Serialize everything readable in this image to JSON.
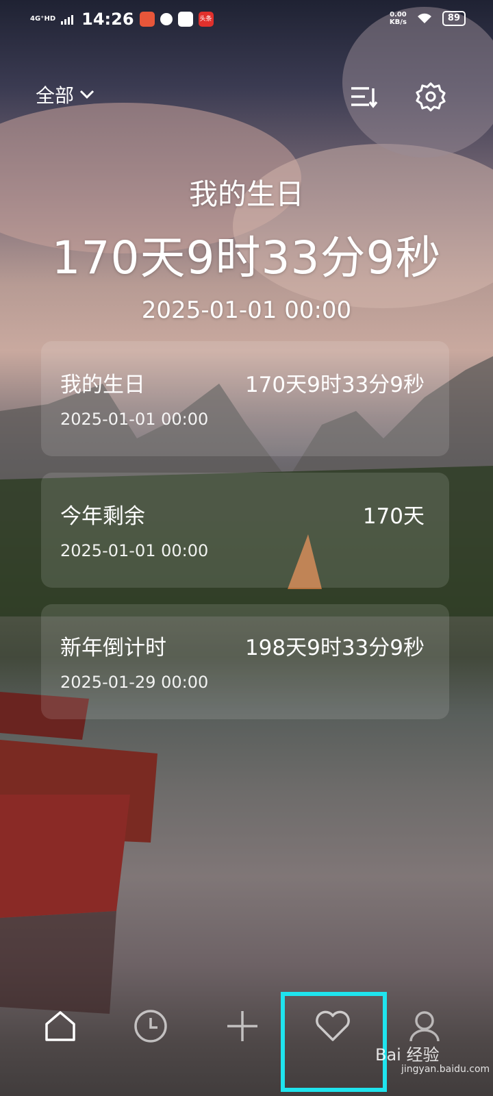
{
  "status_bar": {
    "network": "4G⁺HD",
    "time": "14:26",
    "net_speed_value": "0.00",
    "net_speed_unit": "KB/s",
    "battery": "89",
    "app_icons": [
      "calendar-app-icon",
      "clock-app-icon",
      "mail-app-icon",
      "toutiao-app-icon"
    ],
    "app_label_toutiao": "头条"
  },
  "header": {
    "filter_label": "全部",
    "sort_icon": "sort-list-icon",
    "settings_icon": "gear-icon"
  },
  "hero": {
    "title": "我的生日",
    "countdown": "170天9时33分9秒",
    "date": "2025-01-01 00:00"
  },
  "events": [
    {
      "name": "我的生日",
      "value": "170天9时33分9秒",
      "date": "2025-01-01 00:00"
    },
    {
      "name": "今年剩余",
      "value": "170天",
      "date": "2025-01-01 00:00"
    },
    {
      "name": "新年倒计时",
      "value": "198天9时33分9秒",
      "date": "2025-01-29 00:00"
    }
  ],
  "tabbar": {
    "tabs": [
      "home-icon",
      "clock-icon",
      "plus-icon",
      "heart-icon",
      "user-icon"
    ],
    "highlight_color": "#1fe4ee"
  },
  "watermark": {
    "text": "Bai 经验",
    "sub": "jingyan.baidu.com"
  }
}
